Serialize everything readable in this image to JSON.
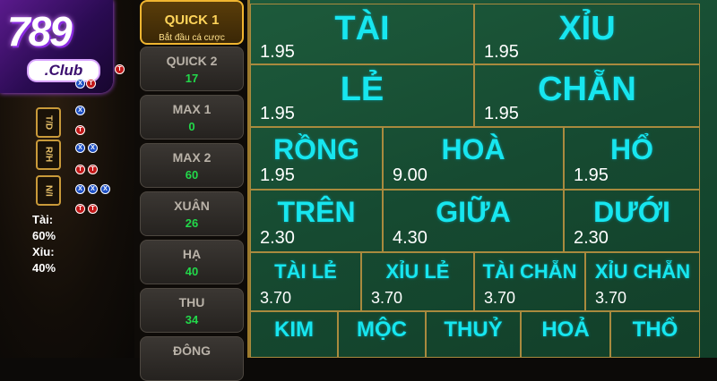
{
  "logo": {
    "number": "789",
    "suffix": ".Club"
  },
  "history": {
    "tags": [
      "T/D",
      "R/H",
      "N/I"
    ],
    "stats": [
      {
        "label": "Tài:",
        "value": "60%"
      },
      {
        "label": "Xỉu:",
        "value": "40%"
      }
    ]
  },
  "modes": [
    {
      "name": "QUICK 1",
      "sub": "Bắt đầu cá cược",
      "active": true
    },
    {
      "name": "QUICK 2",
      "value": "17"
    },
    {
      "name": "MAX 1",
      "value": "0"
    },
    {
      "name": "MAX 2",
      "value": "60"
    },
    {
      "name": "XUÂN",
      "value": "26"
    },
    {
      "name": "HẠ",
      "value": "40"
    },
    {
      "name": "THU",
      "value": "34"
    },
    {
      "name": "ĐÔNG",
      "value": ""
    }
  ],
  "bets": {
    "row1": [
      {
        "label": "TÀI",
        "odd": "1.95"
      },
      {
        "label": "XỈU",
        "odd": "1.95"
      }
    ],
    "row2": [
      {
        "label": "LẺ",
        "odd": "1.95"
      },
      {
        "label": "CHẴN",
        "odd": "1.95"
      }
    ],
    "row3": [
      {
        "label": "RỒNG",
        "odd": "1.95"
      },
      {
        "label": "HOÀ",
        "odd": "9.00"
      },
      {
        "label": "HỔ",
        "odd": "1.95"
      }
    ],
    "row4": [
      {
        "label": "TRÊN",
        "odd": "2.30"
      },
      {
        "label": "GIỮA",
        "odd": "4.30"
      },
      {
        "label": "DƯỚI",
        "odd": "2.30"
      }
    ],
    "row5": [
      {
        "label": "TÀI LẺ",
        "odd": "3.70"
      },
      {
        "label": "XỈU LẺ",
        "odd": "3.70"
      },
      {
        "label": "TÀI CHẴN",
        "odd": "3.70"
      },
      {
        "label": "XỈU CHẴN",
        "odd": "3.70"
      }
    ],
    "row6": [
      {
        "label": "KIM"
      },
      {
        "label": "MỘC"
      },
      {
        "label": "THUỶ"
      },
      {
        "label": "HOẢ"
      },
      {
        "label": "THỔ"
      }
    ]
  },
  "colors": {
    "label": "#17e6ef",
    "odd": "#ffffff",
    "felt": "#1a5236",
    "gold": "#a98a3e",
    "mode_value": "#22d94a"
  }
}
